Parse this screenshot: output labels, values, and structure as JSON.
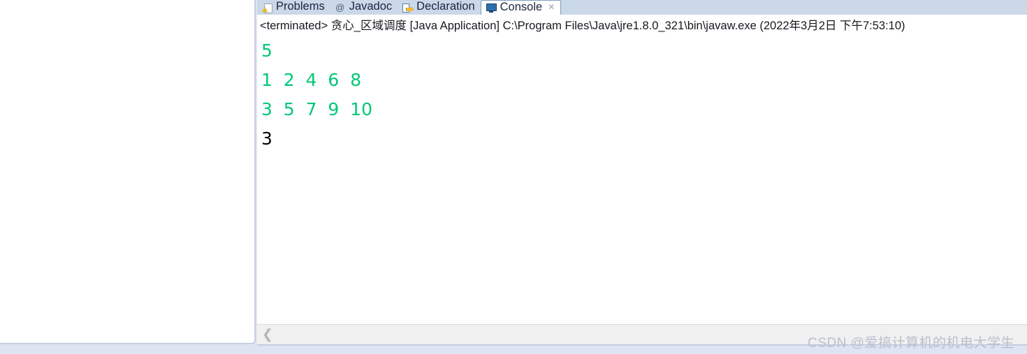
{
  "window": {
    "background_color": "#dfe4f3",
    "panel_background": "#ffffff"
  },
  "left_panel": {
    "name": "editor-panel",
    "content": ""
  },
  "console_view": {
    "tabs": [
      {
        "label": "Problems",
        "icon": "problems-icon",
        "active": false,
        "closable": false
      },
      {
        "label": "Javadoc",
        "icon": "javadoc-icon",
        "active": false,
        "closable": false
      },
      {
        "label": "Declaration",
        "icon": "declaration-icon",
        "active": false,
        "closable": false
      },
      {
        "label": "Console",
        "icon": "console-icon",
        "active": true,
        "closable": true
      }
    ],
    "close_glyph": "✕",
    "javadoc_glyph": "@",
    "launch_line": "<terminated> 贪心_区域调度 [Java Application] C:\\Program Files\\Java\\jre1.8.0_321\\bin\\javaw.exe (2022年3月2日 下午7:53:10)",
    "output_lines": [
      {
        "text": "5",
        "color": "#00c878"
      },
      {
        "text": "1  2  4  6  8",
        "color": "#00c878"
      },
      {
        "text": "3  5  7  9  10",
        "color": "#00c878"
      },
      {
        "text": "3",
        "color": "#000000"
      }
    ],
    "scrollbar": {
      "left_arrow_glyph": "❮",
      "track_color": "#f0f0f0"
    }
  },
  "watermark": {
    "text": "CSDN @爱搞计算机的机电大学生",
    "color": "#b9bfcd"
  },
  "colors": {
    "tab_bar": "#cbd8e8",
    "active_tab": "#ffffff",
    "stdout_green": "#00c878",
    "stdout_black": "#000000",
    "panel_border": "#c6cee3"
  }
}
